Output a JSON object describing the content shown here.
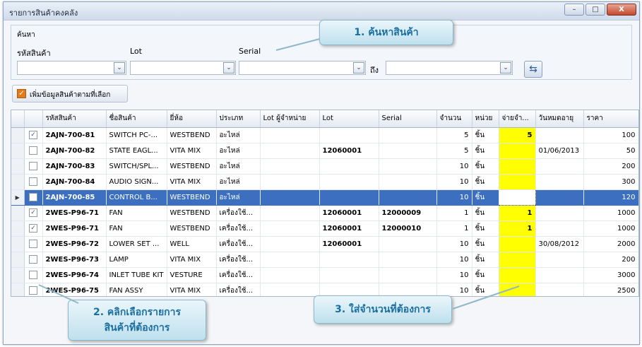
{
  "window": {
    "title": "รายการสินค้าคงคลัง",
    "min": "–",
    "max": "□",
    "close": "X"
  },
  "search": {
    "group_label": "ค้นหา",
    "product_code_label": "รหัสสินค้า",
    "lot_label": "Lot",
    "serial_label": "Serial",
    "to_label": "ถึง",
    "go_icon": "refresh-search-icon"
  },
  "add_button": {
    "label": "เพิ่มข้อมูลสินค้าตามที่เลือก"
  },
  "grid": {
    "columns": [
      "รหัสสินค้า",
      "ชื่อสินค้า",
      "ยี่ห้อ",
      "ประเภท",
      "Lot ผู้จำหน่าย",
      "Lot",
      "Serial",
      "จำนวน",
      "หน่วย",
      "จ่ายจำ...",
      "วันหมดอายุ",
      "ราคา"
    ],
    "rows": [
      {
        "checked": true,
        "code": "2AJN-700-81",
        "name": "SWITCH PC-...",
        "brand": "WESTBEND",
        "type": "อะไหล่",
        "vlot": "",
        "lot": "",
        "serial": "",
        "qty": "5",
        "unit": "ชิ้น",
        "issue": "5",
        "exp": "",
        "price": "100"
      },
      {
        "checked": false,
        "code": "2AJN-700-82",
        "name": "STATE EAGL...",
        "brand": "VITA MIX",
        "type": "อะไหล่",
        "vlot": "",
        "lot": "12060001",
        "serial": "",
        "qty": "5",
        "unit": "ชิ้น",
        "issue": "",
        "exp": "01/06/2013",
        "price": "50"
      },
      {
        "checked": false,
        "code": "2AJN-700-83",
        "name": "SWITCH/SPL...",
        "brand": "WESTBEND",
        "type": "อะไหล่",
        "vlot": "",
        "lot": "",
        "serial": "",
        "qty": "10",
        "unit": "ชิ้น",
        "issue": "",
        "exp": "",
        "price": "200"
      },
      {
        "checked": false,
        "code": "2AJN-700-84",
        "name": "AUDIO SIGN...",
        "brand": "VITA MIX",
        "type": "อะไหล่",
        "vlot": "",
        "lot": "",
        "serial": "",
        "qty": "10",
        "unit": "ชิ้น",
        "issue": "",
        "exp": "",
        "price": "300"
      },
      {
        "checked": false,
        "code": "2AJN-700-85",
        "name": "CONTROL B...",
        "brand": "WESTBEND",
        "type": "อะไหล่",
        "vlot": "",
        "lot": "",
        "serial": "",
        "qty": "10",
        "unit": "ชิ้น",
        "issue": "",
        "exp": "",
        "price": "120",
        "selected": true
      },
      {
        "checked": true,
        "code": "2WES-P96-71",
        "name": "FAN",
        "brand": "WESTBEND",
        "type": "เครื่องใช้...",
        "vlot": "",
        "lot": "12060001",
        "serial": "12000009",
        "qty": "1",
        "unit": "ชิ้น",
        "issue": "1",
        "exp": "",
        "price": "1000"
      },
      {
        "checked": true,
        "code": "2WES-P96-71",
        "name": "FAN",
        "brand": "WESTBEND",
        "type": "เครื่องใช้...",
        "vlot": "",
        "lot": "12060001",
        "serial": "12000010",
        "qty": "1",
        "unit": "ชิ้น",
        "issue": "1",
        "exp": "",
        "price": "1000"
      },
      {
        "checked": false,
        "code": "2WES-P96-72",
        "name": "LOWER SET ...",
        "brand": "WELL",
        "type": "เครื่องใช้...",
        "vlot": "",
        "lot": "12060001",
        "serial": "",
        "qty": "10",
        "unit": "ชิ้น",
        "issue": "",
        "exp": "30/08/2012",
        "price": "2000"
      },
      {
        "checked": false,
        "code": "2WES-P96-73",
        "name": "LAMP",
        "brand": "VITA MIX",
        "type": "เครื่องใช้...",
        "vlot": "",
        "lot": "",
        "serial": "",
        "qty": "10",
        "unit": "ชิ้น",
        "issue": "",
        "exp": "",
        "price": "200"
      },
      {
        "checked": false,
        "code": "2WES-P96-74",
        "name": "INLET TUBE KIT",
        "brand": "VESTURE",
        "type": "เครื่องใช้...",
        "vlot": "",
        "lot": "",
        "serial": "",
        "qty": "10",
        "unit": "ชิ้น",
        "issue": "",
        "exp": "",
        "price": "3000"
      },
      {
        "checked": false,
        "code": "2WES-P96-75",
        "name": "FAN ASSY",
        "brand": "VITA MIX",
        "type": "เครื่องใช้...",
        "vlot": "",
        "lot": "",
        "serial": "",
        "qty": "10",
        "unit": "ชิ้น",
        "issue": "",
        "exp": "",
        "price": "2500"
      }
    ]
  },
  "callouts": {
    "c1": "1. ค้นหาสินค้า",
    "c2_line1": "2. คลิกเลือกรายการ",
    "c2_line2": "สินค้าที่ต้องการ",
    "c3": "3. ใส่จำนวนที่ต้องการ"
  },
  "colors": {
    "selected_row": "#3d6fc1",
    "issue_highlight": "#ffff00",
    "callout_text": "#1a6fa0"
  }
}
